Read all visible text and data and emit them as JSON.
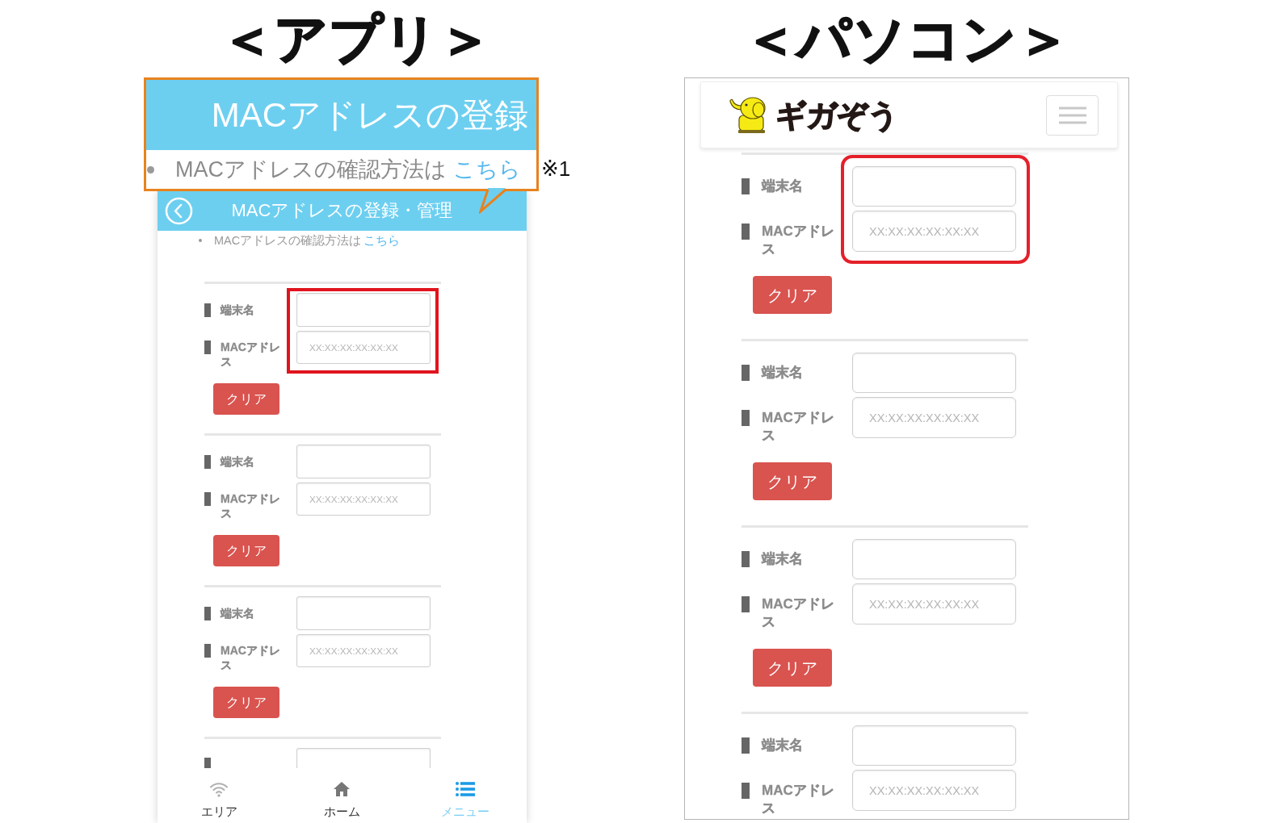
{
  "app": {
    "heading": "＜アプリ＞",
    "callout": {
      "title": "MACアドレスの登録",
      "note": "MACアドレスの確認方法は",
      "link": "こちら"
    },
    "footnote_mark": "※1",
    "header": {
      "title": "MACアドレスの登録・管理"
    },
    "note": {
      "text": "MACアドレスの確認方法は",
      "link": "こちら"
    },
    "entries": [
      {
        "name_label": "端末名",
        "mac_label": "MACアドレス",
        "mac_placeholder": "XX:XX:XX:XX:XX:XX",
        "clear_button": "クリア",
        "highlighted": true,
        "cut_off": false
      },
      {
        "name_label": "端末名",
        "mac_label": "MACアドレス",
        "mac_placeholder": "XX:XX:XX:XX:XX:XX",
        "clear_button": "クリア",
        "highlighted": false,
        "cut_off": false
      },
      {
        "name_label": "端末名",
        "mac_label": "MACアドレス",
        "mac_placeholder": "XX:XX:XX:XX:XX:XX",
        "clear_button": "クリア",
        "highlighted": false,
        "cut_off": false
      },
      {
        "highlighted": false,
        "cut_off": true
      }
    ],
    "bottom_nav": [
      {
        "kind": "wifi",
        "label": "エリア",
        "selected": false
      },
      {
        "kind": "home",
        "label": "ホーム",
        "selected": false
      },
      {
        "kind": "list",
        "label": "メニュー",
        "selected": true
      }
    ]
  },
  "pc": {
    "heading": "＜パソコン＞",
    "brand": "ギガぞう",
    "entries": [
      {
        "name_label": "端末名",
        "mac_label": "MACアドレス",
        "mac_placeholder": "XX:XX:XX:XX:XX:XX",
        "clear_button": "クリア",
        "highlighted": true
      },
      {
        "name_label": "端末名",
        "mac_label": "MACアドレス",
        "mac_placeholder": "XX:XX:XX:XX:XX:XX",
        "clear_button": "クリア",
        "highlighted": false
      },
      {
        "name_label": "端末名",
        "mac_label": "MACアドレス",
        "mac_placeholder": "XX:XX:XX:XX:XX:XX",
        "clear_button": "クリア",
        "highlighted": false
      },
      {
        "name_label": "端末名",
        "mac_label": "MACアドレス",
        "mac_placeholder": "XX:XX:XX:XX:XX:XX",
        "highlighted": false
      }
    ]
  }
}
